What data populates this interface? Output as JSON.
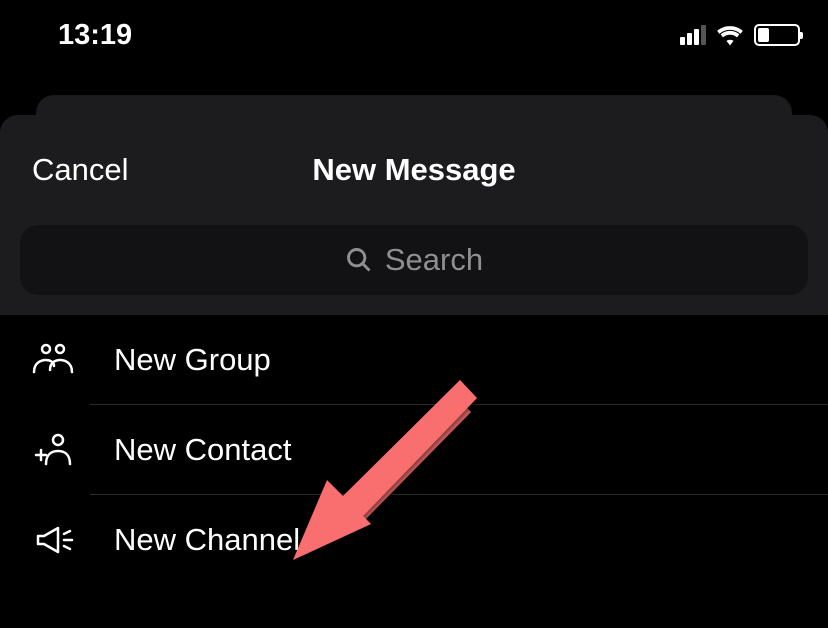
{
  "status": {
    "time": "13:19"
  },
  "sheet": {
    "cancel": "Cancel",
    "title": "New Message",
    "search_placeholder": "Search"
  },
  "options": {
    "group": "New Group",
    "contact": "New Contact",
    "channel": "New Channel"
  }
}
